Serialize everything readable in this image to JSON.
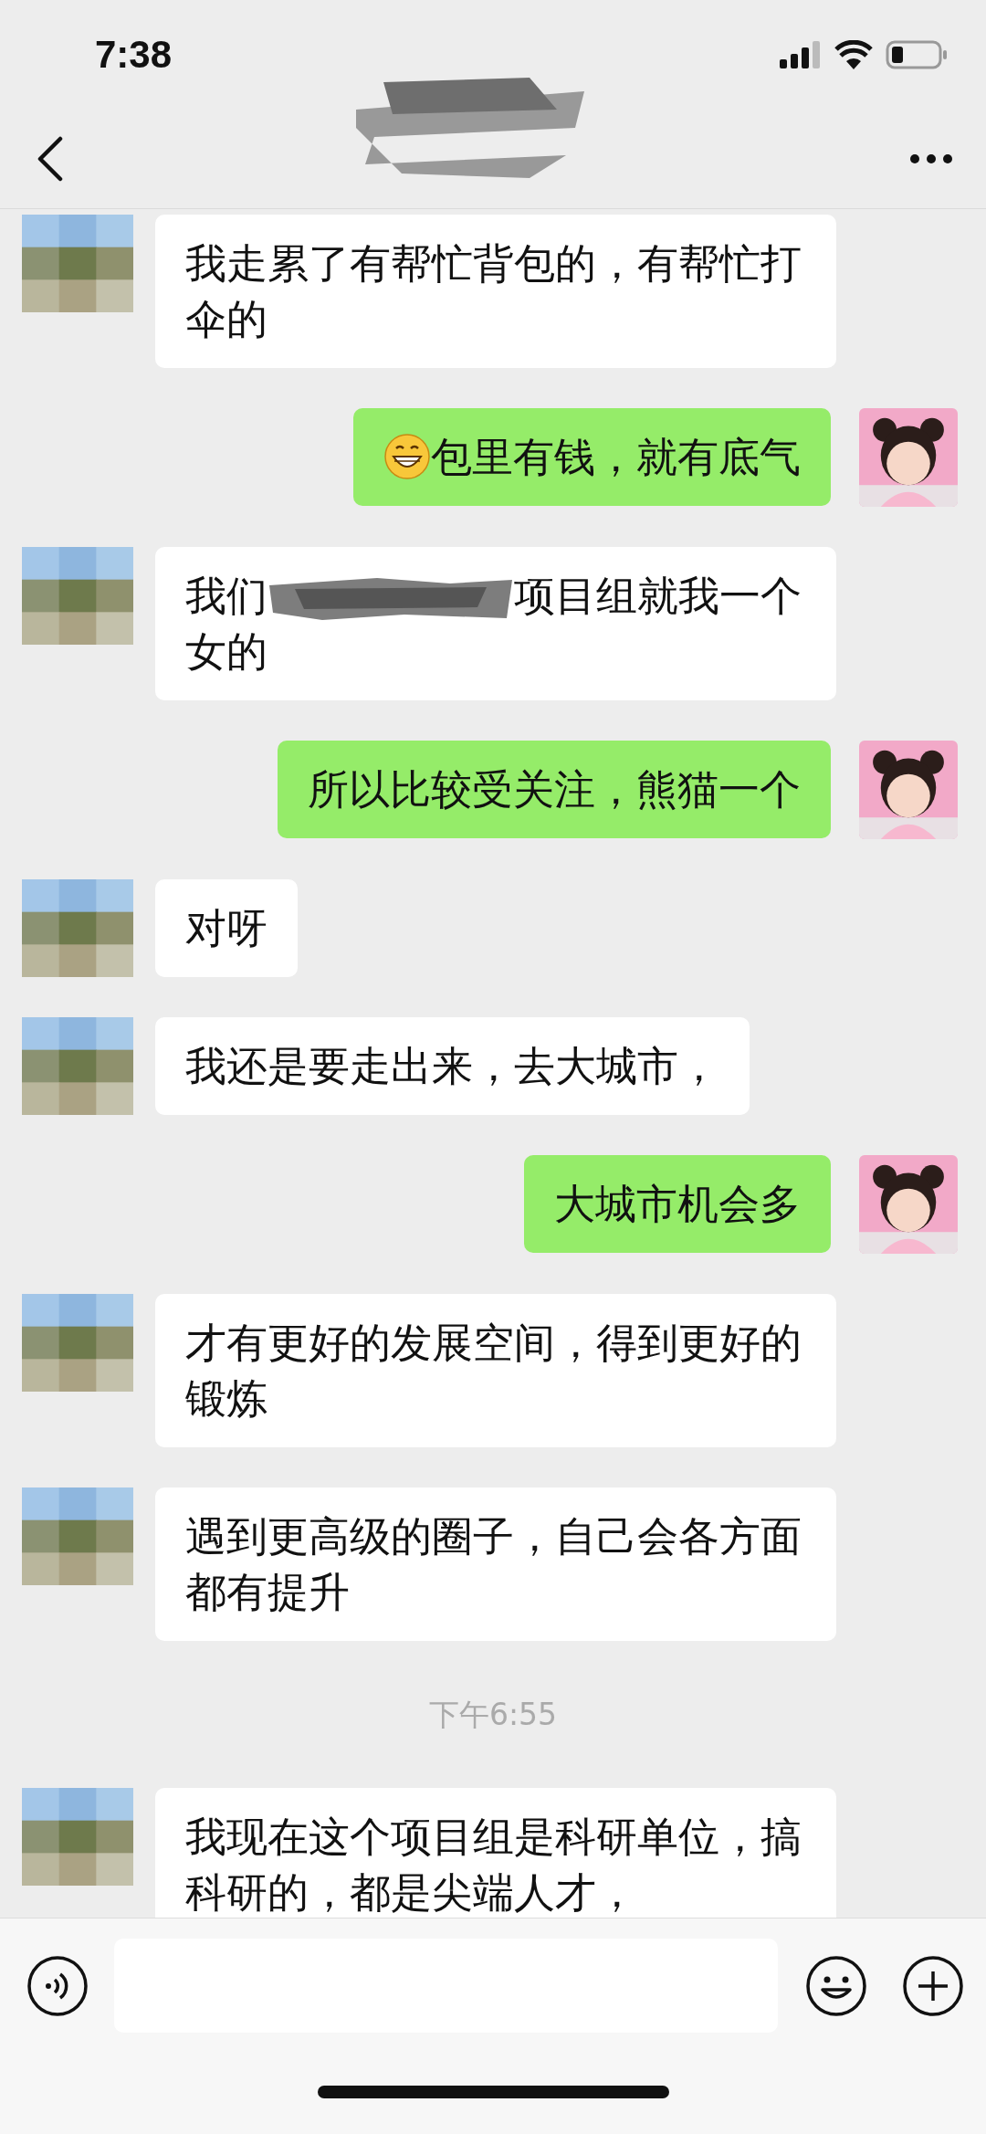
{
  "status_bar": {
    "time": "7:38"
  },
  "nav": {
    "title_redacted": true
  },
  "messages": [
    {
      "kind": "message",
      "outgoing": false,
      "text": "我走累了有帮忙背包的，有帮忙打伞的"
    },
    {
      "kind": "message",
      "outgoing": true,
      "leading_emoji": true,
      "text": "包里有钱，就有底气"
    },
    {
      "kind": "message",
      "outgoing": false,
      "text": "我们",
      "redacted": true,
      "text_after": "项目组就我一个女的"
    },
    {
      "kind": "message",
      "outgoing": true,
      "text": "所以比较受关注，熊猫一个"
    },
    {
      "kind": "message",
      "outgoing": false,
      "text": "对呀"
    },
    {
      "kind": "message",
      "outgoing": false,
      "text": "我还是要走出来，去大城市，"
    },
    {
      "kind": "message",
      "outgoing": true,
      "text": "大城市机会多"
    },
    {
      "kind": "message",
      "outgoing": false,
      "text": "才有更好的发展空间，得到更好的锻炼"
    },
    {
      "kind": "message",
      "outgoing": false,
      "text": "遇到更高级的圈子，自己会各方面都有提升"
    },
    {
      "kind": "time",
      "text": "下午6:55"
    },
    {
      "kind": "message",
      "outgoing": false,
      "text": "我现在这个项目组是科研单位，搞科研的，都是尖端人才，"
    }
  ]
}
